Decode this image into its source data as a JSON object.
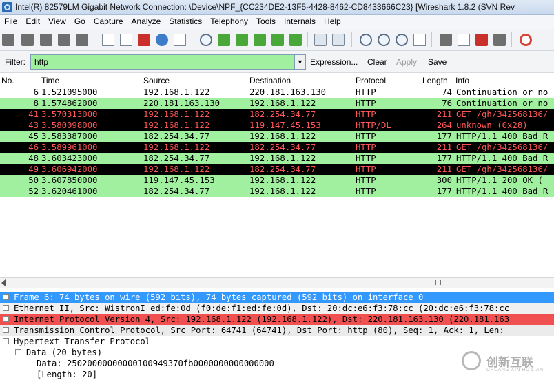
{
  "window": {
    "title": "Intel(R) 82579LM Gigabit Network Connection: \\Device\\NPF_{CC234DE2-13F5-4428-8462-CD8433666C23}   [Wireshark 1.8.2  (SVN Rev"
  },
  "menu": [
    "File",
    "Edit",
    "View",
    "Go",
    "Capture",
    "Analyze",
    "Statistics",
    "Telephony",
    "Tools",
    "Internals",
    "Help"
  ],
  "toolbar_icons": [
    "interface-list-icon",
    "capture-options-icon",
    "start-capture-icon",
    "stop-capture-icon",
    "restart-capture-icon",
    "open-file-icon",
    "save-file-icon",
    "close-file-icon",
    "reload-icon",
    "print-icon",
    "find-packet-icon",
    "go-back-icon",
    "go-forward-icon",
    "go-to-packet-icon",
    "go-first-icon",
    "go-last-icon",
    "colorize-icon",
    "auto-scroll-icon",
    "zoom-in-icon",
    "zoom-out-icon",
    "normal-size-icon",
    "resize-columns-icon",
    "capture-filters-icon",
    "display-filters-icon",
    "coloring-rules-icon",
    "preferences-icon",
    "help-icon"
  ],
  "filter": {
    "label": "Filter:",
    "value": "http",
    "expression": "Expression...",
    "clear": "Clear",
    "apply": "Apply",
    "save": "Save"
  },
  "columns": [
    "No.",
    "Time",
    "Source",
    "Destination",
    "Protocol",
    "Length",
    "Info"
  ],
  "packets": [
    {
      "no": "6",
      "time": "1.521095000",
      "src": "192.168.1.122",
      "dst": "220.181.163.130",
      "proto": "HTTP",
      "len": "74",
      "info": "Continuation or no",
      "style": "white"
    },
    {
      "no": "8",
      "time": "1.574862000",
      "src": "220.181.163.130",
      "dst": "192.168.1.122",
      "proto": "HTTP",
      "len": "76",
      "info": "Continuation or no",
      "style": "green"
    },
    {
      "no": "41",
      "time": "3.570313000",
      "src": "192.168.1.122",
      "dst": "182.254.34.77",
      "proto": "HTTP",
      "len": "211",
      "info": "GET /gh/342568136/",
      "style": "black"
    },
    {
      "no": "43",
      "time": "3.580098000",
      "src": "192.168.1.122",
      "dst": "119.147.45.153",
      "proto": "HTTP/DL",
      "len": "264",
      "info": "unknown (0x28)",
      "style": "black"
    },
    {
      "no": "45",
      "time": "3.583387000",
      "src": "182.254.34.77",
      "dst": "192.168.1.122",
      "proto": "HTTP",
      "len": "177",
      "info": "HTTP/1.1 400 Bad R",
      "style": "green"
    },
    {
      "no": "46",
      "time": "3.589961000",
      "src": "192.168.1.122",
      "dst": "182.254.34.77",
      "proto": "HTTP",
      "len": "211",
      "info": "GET /gh/342568136/",
      "style": "black"
    },
    {
      "no": "48",
      "time": "3.603423000",
      "src": "182.254.34.77",
      "dst": "192.168.1.122",
      "proto": "HTTP",
      "len": "177",
      "info": "HTTP/1.1 400 Bad R",
      "style": "green"
    },
    {
      "no": "49",
      "time": "3.606942000",
      "src": "192.168.1.122",
      "dst": "182.254.34.77",
      "proto": "HTTP",
      "len": "211",
      "info": "GET /gh/342568136/",
      "style": "black"
    },
    {
      "no": "50",
      "time": "3.607850000",
      "src": "119.147.45.153",
      "dst": "192.168.1.122",
      "proto": "HTTP",
      "len": "300",
      "info": "HTTP/1.1 200 OK  (",
      "style": "green"
    },
    {
      "no": "52",
      "time": "3.620461000",
      "src": "182.254.34.77",
      "dst": "192.168.1.122",
      "proto": "HTTP",
      "len": "177",
      "info": "HTTP/1.1 400 Bad R",
      "style": "green"
    }
  ],
  "details": [
    {
      "text": "Frame 6: 74 bytes on wire (592 bits), 74 bytes captured (592 bits) on interface 0",
      "style": "selected",
      "exp": "+",
      "indent": 0
    },
    {
      "text": "Ethernet II, Src: WistronI_ed:fe:0d (f0:de:f1:ed:fe:0d), Dst: 20:dc:e6:f3:78:cc (20:dc:e6:f3:78:cc",
      "style": "eth",
      "exp": "+",
      "indent": 0
    },
    {
      "text": "Internet Protocol Version 4, Src: 192.168.1.122 (192.168.1.122), Dst: 220.181.163.130 (220.181.163",
      "style": "ip",
      "exp": "+",
      "indent": 0
    },
    {
      "text": "Transmission Control Protocol, Src Port: 64741 (64741), Dst Port: http (80), Seq: 1, Ack: 1, Len:",
      "style": "tcp",
      "exp": "+",
      "indent": 0
    },
    {
      "text": "Hypertext Transfer Protocol",
      "style": "http",
      "exp": "−",
      "indent": 0
    },
    {
      "text": "Data (20 bytes)",
      "style": "http",
      "exp": "−",
      "indent": 1
    },
    {
      "text": "Data: 25020000000000100949370fb0000000000000000",
      "style": "http",
      "exp": "",
      "indent": 2
    },
    {
      "text": "[Length: 20]",
      "style": "http",
      "exp": "",
      "indent": 2
    }
  ],
  "watermark": {
    "text": "创新互联",
    "sub": "CHUANG XIN HU LIAN"
  }
}
